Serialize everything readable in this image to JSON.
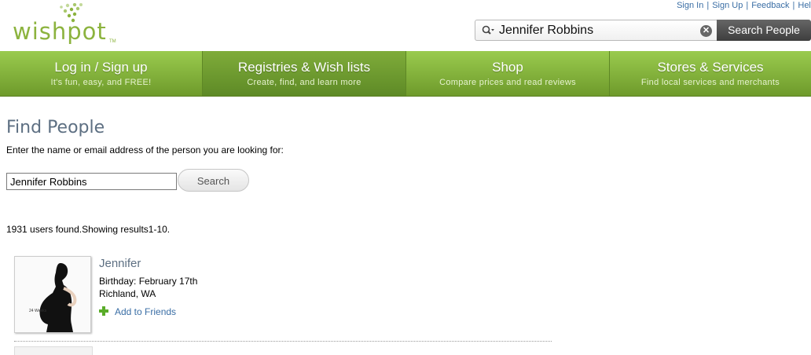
{
  "header": {
    "logo_text": "wishpot",
    "logo_tm": "TM",
    "top_links": [
      "Sign In",
      "Sign Up",
      "Feedback",
      "Help"
    ],
    "search": {
      "value": "Jennifer Robbins",
      "button_label": "Search People",
      "clear_icon": "clear-icon"
    }
  },
  "nav": [
    {
      "title": "Log in / Sign up",
      "subtitle": "It's fun, easy, and FREE!",
      "active": false
    },
    {
      "title": "Registries & Wish lists",
      "subtitle": "Create, find, and learn more",
      "active": true
    },
    {
      "title": "Shop",
      "subtitle": "Compare prices and read reviews",
      "active": false
    },
    {
      "title": "Stores & Services",
      "subtitle": "Find local services and merchants",
      "active": false
    }
  ],
  "main": {
    "title": "Find People",
    "instructions": "Enter the name or email address of the person you are looking for:",
    "input_value": "Jennifer Robbins",
    "search_label": "Search",
    "results_summary": "1931 users found.Showing results1-10."
  },
  "results": [
    {
      "name": "Jennifer",
      "birthday": "Birthday: February 17th",
      "location": "Richland, WA",
      "add_label": "Add to Friends",
      "photo_caption": "24 Weeks"
    }
  ],
  "colors": {
    "nav_green": "#8ab944",
    "link_blue": "#3a6ea5",
    "title_slate": "#5d6f82"
  }
}
